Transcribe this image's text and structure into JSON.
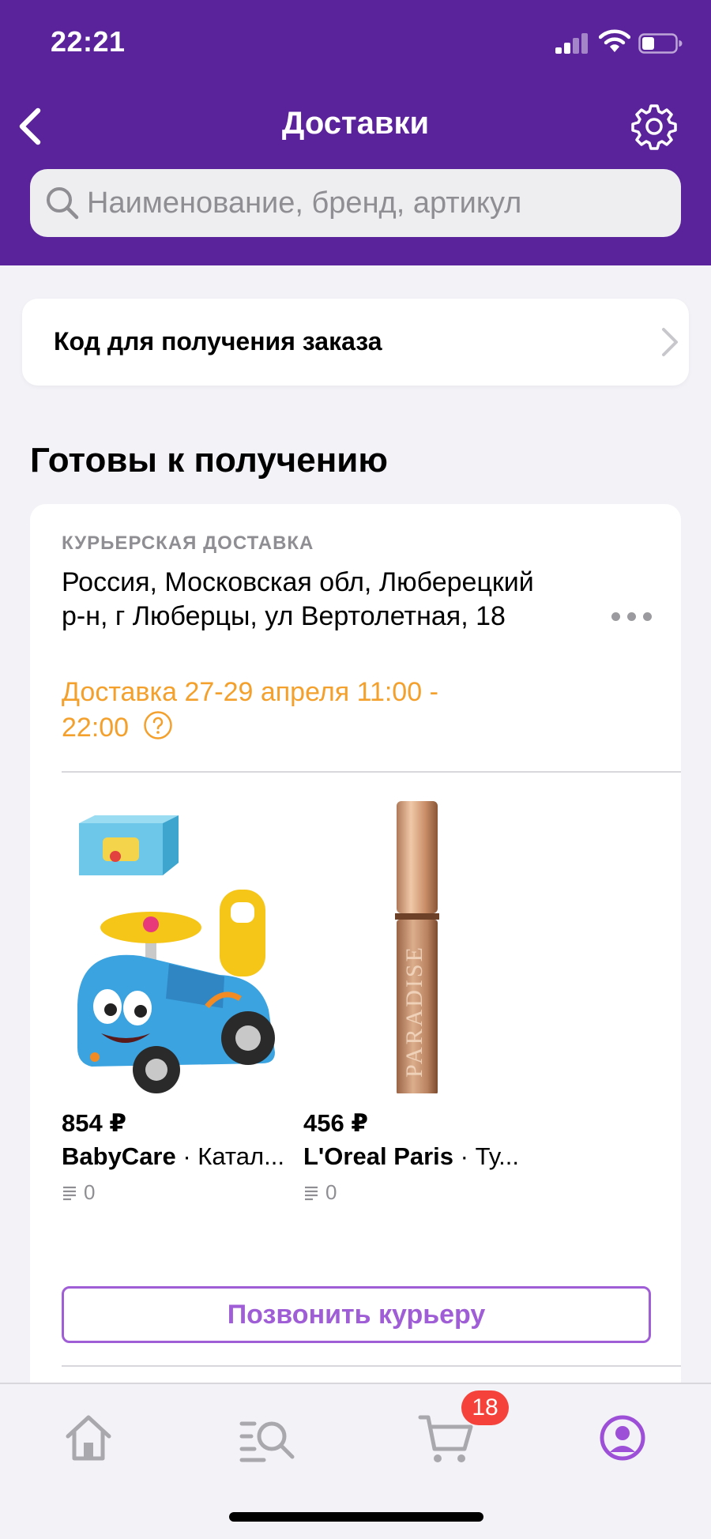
{
  "status_bar": {
    "time": "22:21"
  },
  "header": {
    "title": "Доставки",
    "search_placeholder": "Наименование, бренд, артикул"
  },
  "code_card": {
    "label": "Код для получения заказа"
  },
  "section": {
    "title": "Готовы к получению"
  },
  "delivery": {
    "type": "КУРЬЕРСКАЯ ДОСТАВКА",
    "address": "Россия, Московская обл, Люберецкий р-н, г Люберцы, ул Вертолетная, 18",
    "time": "Доставка 27-29 апреля 11:00 - 22:00",
    "products": [
      {
        "price": "854 ₽",
        "brand": "BabyCare",
        "category": " · Катал...",
        "qty": "0",
        "image_icon": "ride-on-toy-car-icon"
      },
      {
        "price": "456 ₽",
        "brand": "L'Oreal Paris",
        "category": " · Ту...",
        "qty": "0",
        "image_icon": "mascara-tube-icon"
      }
    ],
    "call_button_label": "Позвонить курьеру"
  },
  "tabbar": {
    "items": [
      "home-icon",
      "catalog-search-icon",
      "cart-icon",
      "profile-icon"
    ],
    "cart_badge": "18",
    "active_color": "#9d4fd8"
  },
  "colors": {
    "header": "#5a229b",
    "accent": "#a05ed6",
    "delivery_time": "#f3a02c",
    "badge": "#f5423a"
  }
}
